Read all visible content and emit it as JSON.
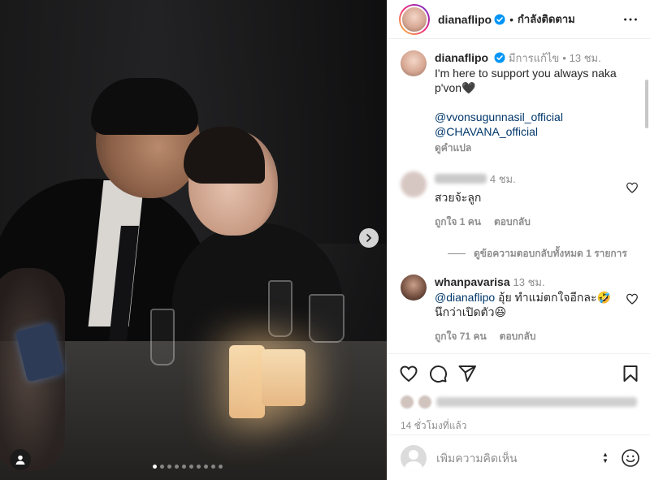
{
  "post": {
    "author": "dianaflipo",
    "follow_status": "กำลังติดตาม",
    "carousel": {
      "slide_count": 10,
      "active_slide": 1
    }
  },
  "caption": {
    "username": "dianaflipo",
    "edited_label": "มีการแก้ไข",
    "time": "13 ชม.",
    "text": "I'm here to support you always naka p'von🖤",
    "tags": [
      "@vvonsugunnasil_official",
      "@CHAVANA_official"
    ],
    "translate": "ดูคำแปล"
  },
  "comments": [
    {
      "username": "",
      "time": "4 ชม.",
      "text": "สวยจ้ะลูก",
      "likes": "ถูกใจ 1 คน",
      "reply": "ตอบกลับ",
      "view_replies": "ดูข้อความตอบกลับทั้งหมด 1 รายการ"
    },
    {
      "username": "whanpavarisa",
      "time": "13 ชม.",
      "mention": "@dianaflipo",
      "text": " อุ้ย ทำแม่ตกใจอีกละ🤣 นึกว่าเปิดตัว😆",
      "likes": "ถูกใจ 71 คน",
      "reply": "ตอบกลับ"
    }
  ],
  "footer": {
    "time_ago": "14 ชั่วโมงที่แล้ว",
    "comment_placeholder": "เพิ่มความคิดเห็น"
  },
  "icons": {
    "verified": "verified-badge-icon",
    "more": "more-options-icon",
    "like": "heart-icon",
    "comment": "comment-icon",
    "share": "paper-plane-icon",
    "save": "bookmark-icon",
    "next": "chevron-right-icon",
    "tag": "user-tag-icon",
    "emoji": "emoji-icon"
  },
  "colors": {
    "link": "#00376b",
    "verified": "#0095f6",
    "muted": "#8e8e8e",
    "text": "#262626"
  }
}
